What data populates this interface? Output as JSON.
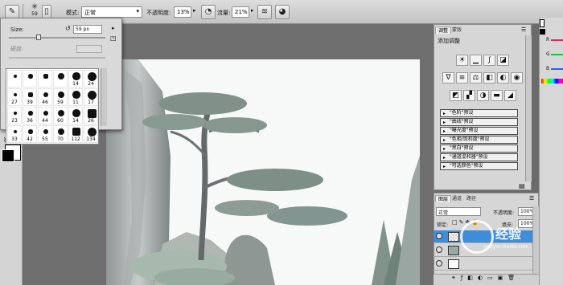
{
  "options_bar": {
    "brush_size": "59",
    "mode_label": "模式:",
    "mode_value": "正常",
    "opacity_label": "不透明度:",
    "opacity_value": "13%",
    "flow_label": "流量:",
    "flow_value": "21%"
  },
  "brush_picker": {
    "size_label": "Size:",
    "size_value": "59 px",
    "hardness_label": "硬度:",
    "brushes": [
      "1",
      "3",
      "5",
      "9",
      "13",
      "19",
      "5",
      "9",
      "13",
      "17",
      "21",
      "27",
      "35",
      "45",
      "65",
      "100",
      "200",
      "300",
      "9",
      "13",
      "19",
      "17",
      "45",
      "65",
      "100",
      "200",
      "300",
      "14",
      "24",
      "27",
      "39",
      "46",
      "59",
      "11",
      "17",
      "23",
      "36",
      "44",
      "60",
      "14",
      "26",
      "33",
      "42",
      "55",
      "70",
      "112",
      "134"
    ],
    "visible_numbers": [
      "14",
      "24",
      "27",
      "39",
      "46",
      "59",
      "11",
      "17",
      "23",
      "36",
      "44",
      "60",
      "14",
      "26",
      "33",
      "42",
      "55",
      "70",
      "112",
      "134"
    ]
  },
  "adjustments_panel": {
    "tabs": [
      "调整",
      "蒙版"
    ],
    "title": "添加调整",
    "presets": [
      "\"色阶\"预设",
      "\"曲线\"预设",
      "\"曝光度\"预设",
      "\"色相/饱和度\"预设",
      "\"黑白\"预设",
      "\"通道混和器\"预设",
      "\"可选颜色\"预设"
    ]
  },
  "color_panel": {
    "channels": [
      "R",
      "G",
      "B"
    ],
    "channel_colors": [
      "#e0245e",
      "#21c04a",
      "#2d5bff"
    ]
  },
  "layers_panel": {
    "tabs": [
      "图层",
      "通道",
      "路径"
    ],
    "blend_mode": "正常",
    "opacity_label": "不透明度:",
    "opacity_value": "100%",
    "lock_label": "锁定:",
    "fill_label": "填充:",
    "fill_value": "100%",
    "layer_names": [
      "",
      "",
      ""
    ]
  },
  "watermark": {
    "text": "经验",
    "subtext": "jingyan.baidu.com"
  }
}
